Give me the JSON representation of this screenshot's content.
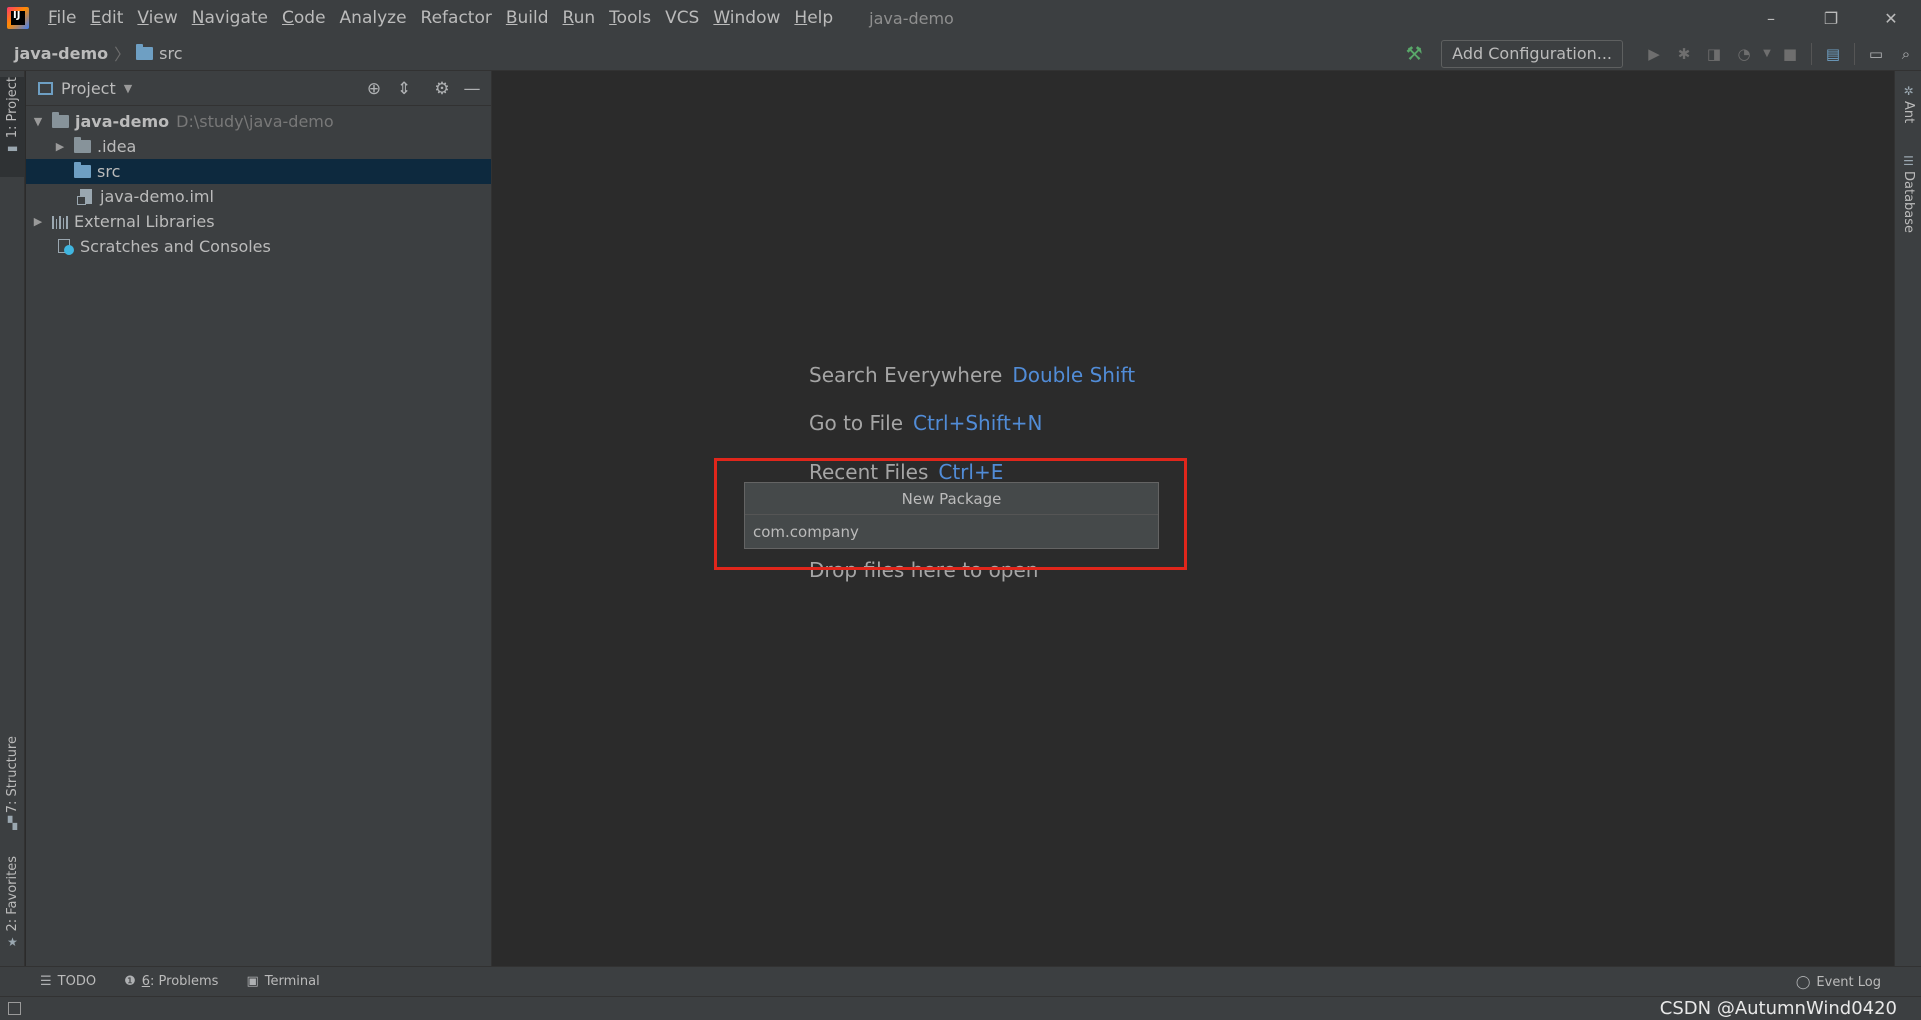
{
  "titlebar": {
    "menu": [
      {
        "key": "F",
        "rest": "ile"
      },
      {
        "key": "E",
        "rest": "dit"
      },
      {
        "key": "V",
        "rest": "iew"
      },
      {
        "key": "N",
        "rest": "avigate"
      },
      {
        "key": "C",
        "rest": "ode"
      },
      {
        "key": "",
        "rest": "Analyze"
      },
      {
        "key": "",
        "rest": "Refactor"
      },
      {
        "key": "B",
        "rest": "uild"
      },
      {
        "key": "R",
        "rest": "un"
      },
      {
        "key": "T",
        "rest": "ools"
      },
      {
        "key": "",
        "rest": "VCS"
      },
      {
        "key": "W",
        "rest": "indow"
      },
      {
        "key": "H",
        "rest": "elp"
      }
    ],
    "window_title": "java-demo",
    "controls": {
      "minimize": "–",
      "restore": "❐",
      "close": "✕"
    }
  },
  "navbar": {
    "root": "java-demo",
    "current": "src",
    "add_configuration": "Add Configuration..."
  },
  "left_stripe": {
    "project_tab": "1: Project",
    "structure_tab": "7: Structure",
    "favorites_tab": "2: Favorites"
  },
  "right_stripe": {
    "ant_tab": "Ant",
    "database_tab": "Database"
  },
  "project_panel": {
    "title": "Project",
    "tree": {
      "root_name": "java-demo",
      "root_path": "D:\\study\\java-demo",
      "idea": ".idea",
      "src": "src",
      "iml": "java-demo.iml",
      "external_libraries": "External Libraries",
      "scratches": "Scratches and Consoles"
    }
  },
  "editor": {
    "search_label": "Search Everywhere",
    "search_key": "Double Shift",
    "goto_label": "Go to File",
    "goto_key": "Ctrl+Shift+N",
    "recent_label": "Recent Files",
    "recent_key": "Ctrl+E",
    "drop_text": "Drop files here to open"
  },
  "new_package_popup": {
    "title": "New Package",
    "value": "com.company"
  },
  "bottom_bar": {
    "todo": "TODO",
    "problems_num": "6",
    "problems": ": Problems",
    "terminal": "Terminal",
    "event_log": "Event Log"
  },
  "watermark": "CSDN @AutumnWind0420",
  "colors": {
    "background": "#2b2b2b",
    "panel": "#3c3f41",
    "selection": "#0d293e",
    "shortcut": "#589df6",
    "highlight_box": "#e0261b",
    "folder_blue": "#6e9fc3"
  }
}
